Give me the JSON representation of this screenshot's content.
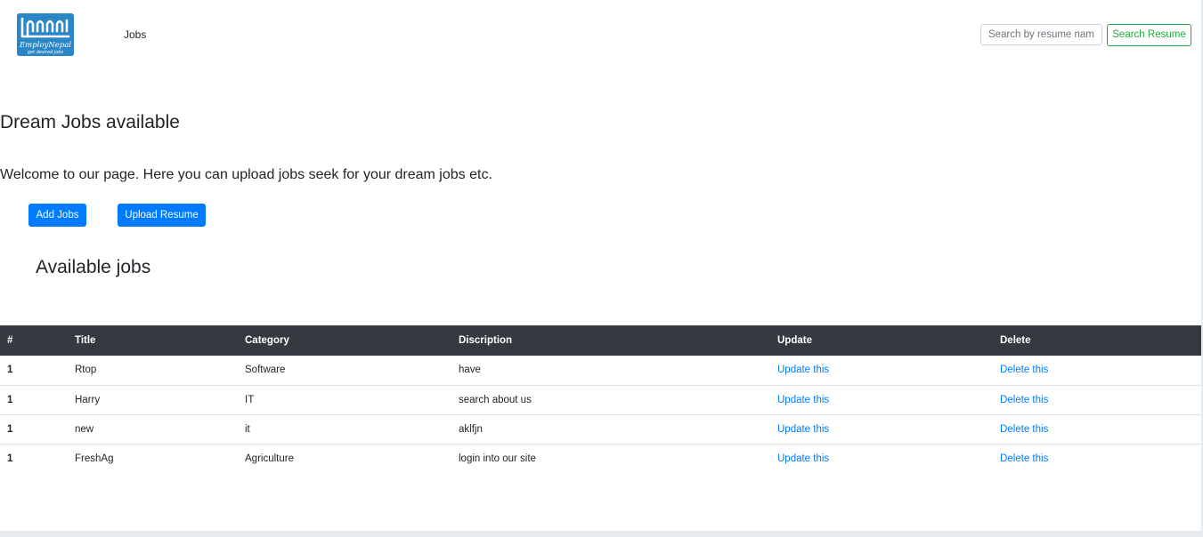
{
  "navbar": {
    "logo": {
      "icon": "employnepal-logo",
      "brand": "EmployNepal",
      "tagline": "get desired jobs"
    },
    "links": [
      "Jobs"
    ],
    "search": {
      "placeholder": "Search by resume name",
      "value": "",
      "button_label": "Search Resume"
    }
  },
  "hero": {
    "title": "Dream Jobs available",
    "text": "Welcome to our page. Here you can upload jobs seek for your dream jobs etc.",
    "buttons": {
      "add_jobs": "Add Jobs",
      "upload_resume": "Upload Resume"
    }
  },
  "jobs_section": {
    "title": "Available jobs"
  },
  "table": {
    "columns": [
      "#",
      "Title",
      "Category",
      "Discription",
      "Update",
      "Delete"
    ],
    "rows": [
      {
        "idx": "1",
        "title": "Rtop",
        "category": "Software",
        "description": "have",
        "update": "Update this",
        "delete": "Delete this"
      },
      {
        "idx": "1",
        "title": "Harry",
        "category": "IT",
        "description": "search about us",
        "update": "Update this",
        "delete": "Delete this"
      },
      {
        "idx": "1",
        "title": "new",
        "category": "it",
        "description": "aklfjn",
        "update": "Update this",
        "delete": "Delete this"
      },
      {
        "idx": "1",
        "title": "FreshAg",
        "category": "Agriculture",
        "description": "login into our site",
        "update": "Update this",
        "delete": "Delete this"
      }
    ]
  },
  "colors": {
    "primary": "#007bff",
    "success": "#28a745",
    "dark": "#343a40",
    "logo_bg": "#2b86c5"
  }
}
